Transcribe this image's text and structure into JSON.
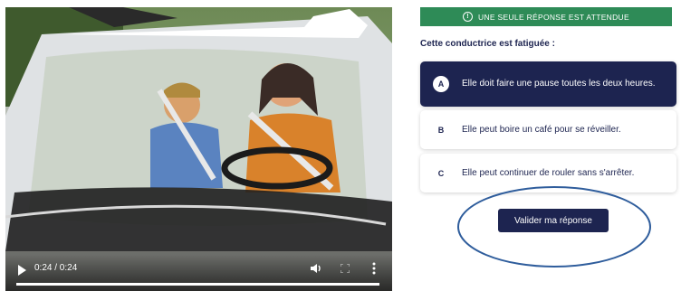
{
  "video": {
    "time_display": "0:24 / 0:24",
    "progress_fraction": 1.0,
    "state": "paused"
  },
  "quiz": {
    "banner": "UNE SEULE RÉPONSE EST ATTENDUE",
    "question": "Cette conductrice est fatiguée :",
    "answers": [
      {
        "letter": "A",
        "text": "Elle doit faire une pause toutes les deux heures.",
        "selected": true
      },
      {
        "letter": "B",
        "text": "Elle peut boire un café pour se réveiller.",
        "selected": false
      },
      {
        "letter": "C",
        "text": "Elle peut continuer de rouler sans s'arrêter.",
        "selected": false
      }
    ],
    "submit_label": "Valider ma réponse"
  },
  "colors": {
    "banner_green": "#2e8b57",
    "navy": "#1d2450",
    "annotation_blue": "#2f5d9c"
  },
  "icons": [
    "play-icon",
    "volume-icon",
    "fullscreen-icon",
    "more-options-icon",
    "info-icon"
  ]
}
